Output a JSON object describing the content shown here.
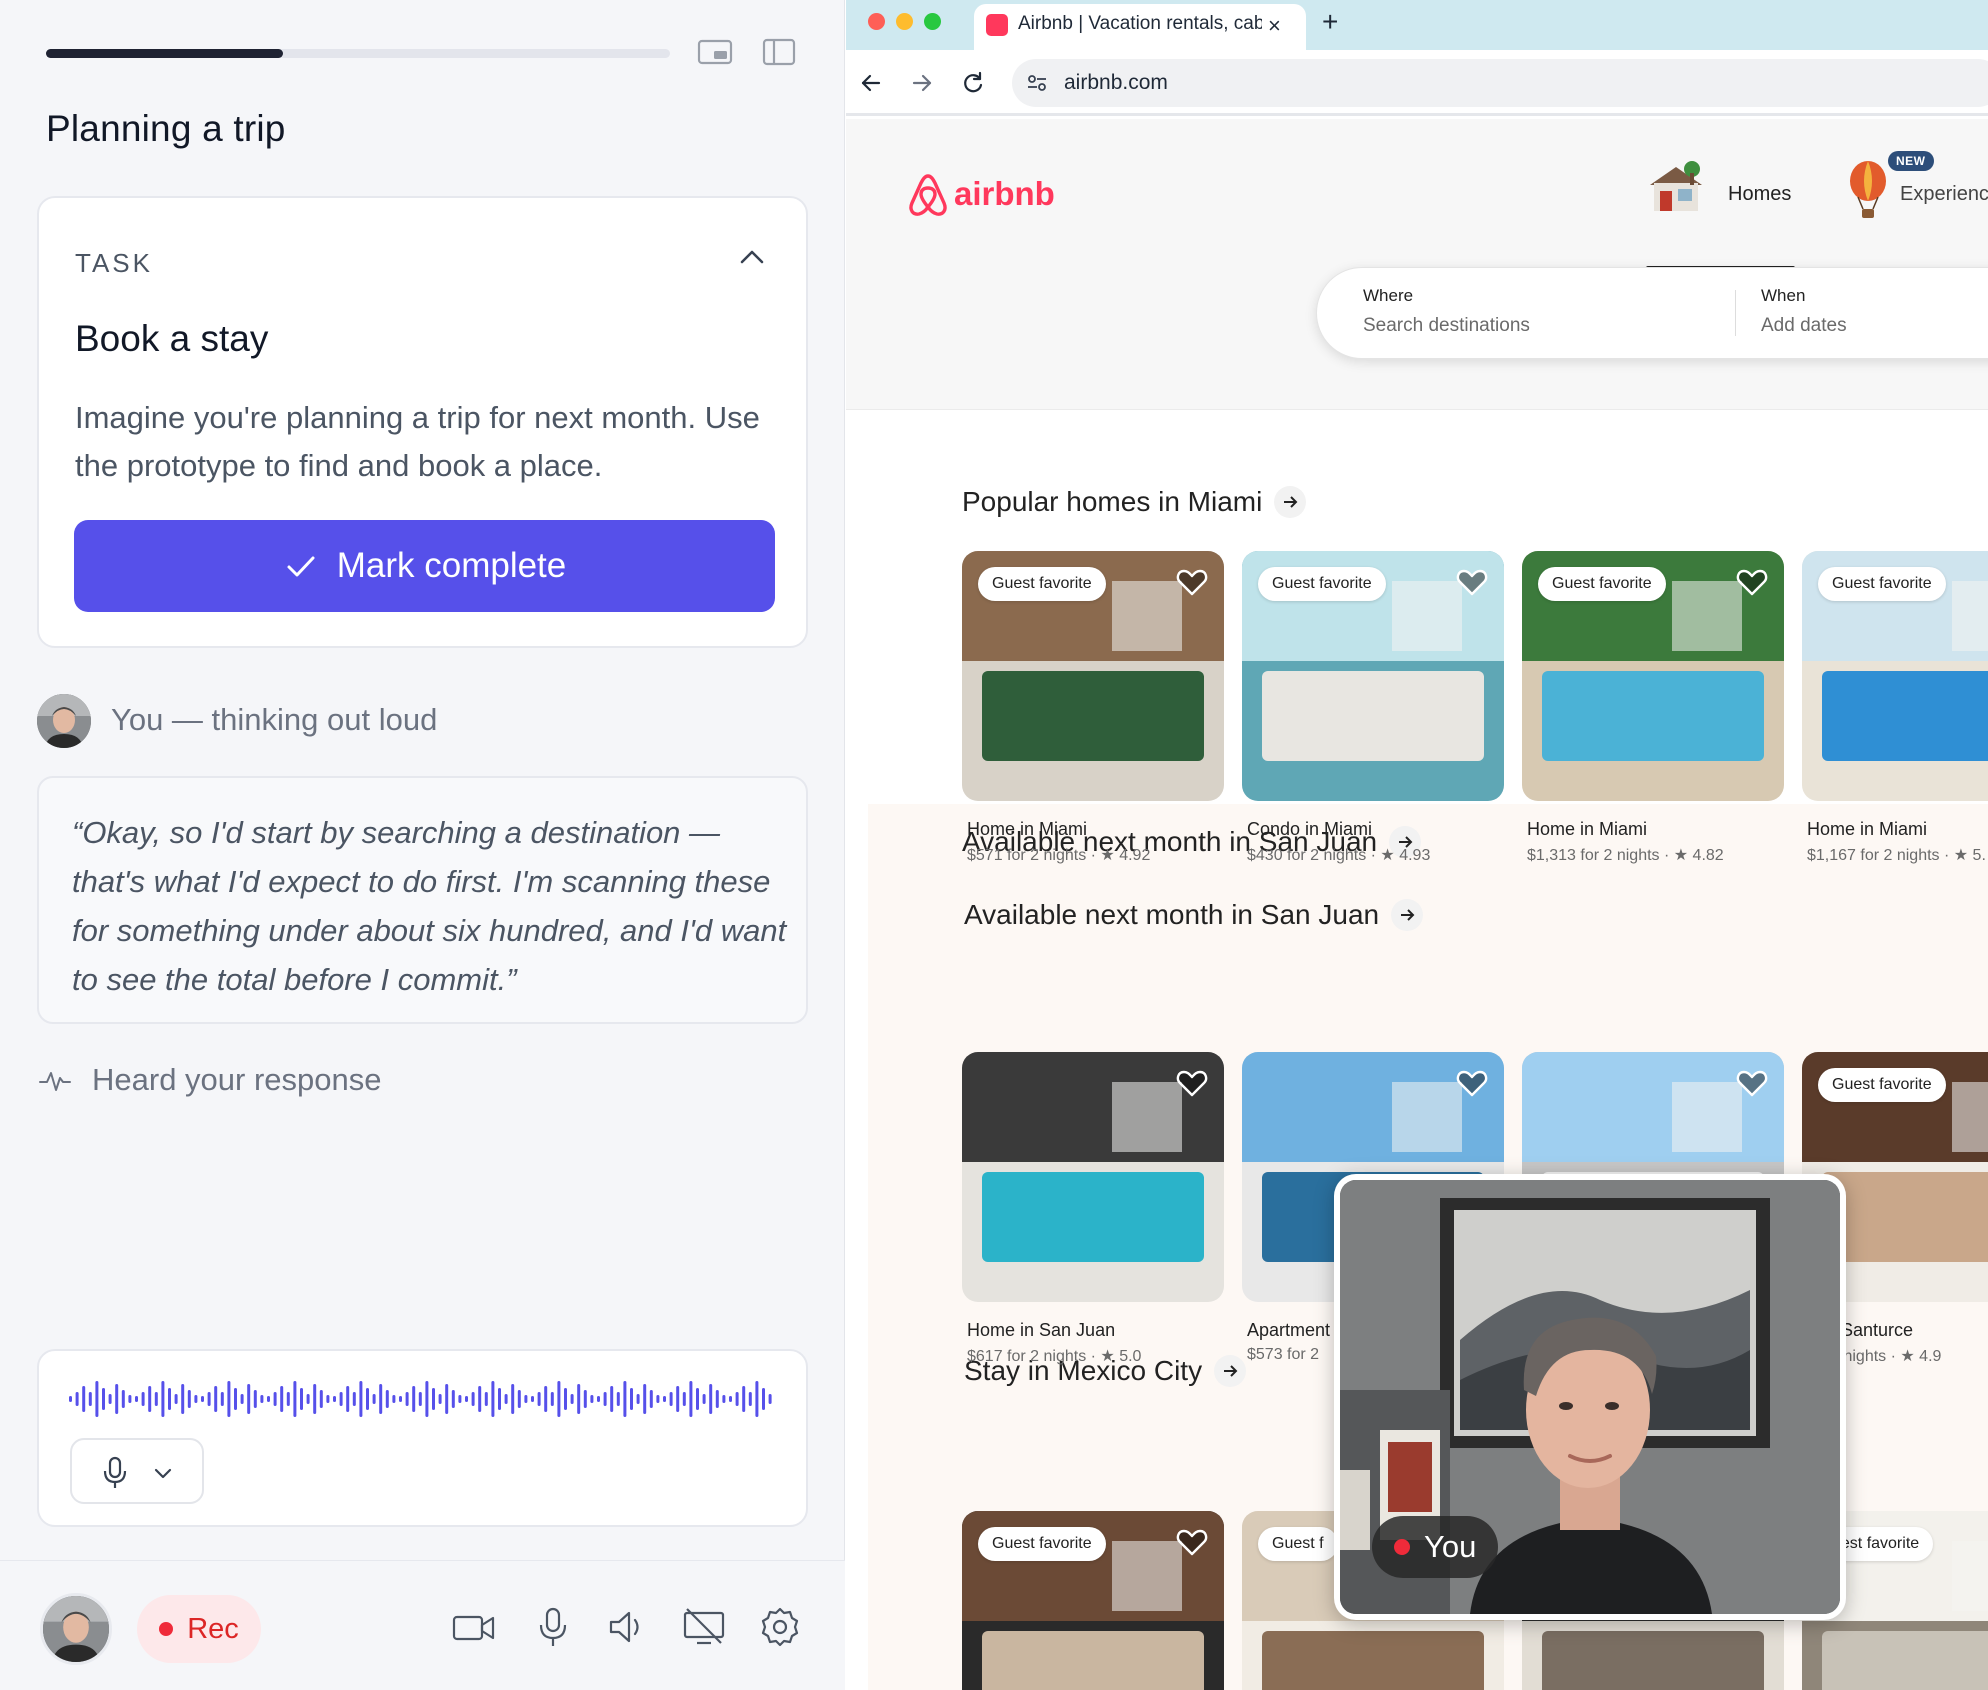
{
  "session": {
    "title": "Planning a trip",
    "progress": 0.38
  },
  "task": {
    "label": "TASK",
    "title": "Book a stay",
    "description": "Imagine you're planning a trip for next month. Use the prototype to find and book a place.",
    "complete_button": "Mark complete"
  },
  "transcript": {
    "speaker": "You — thinking out loud",
    "quote": "“Okay, so I'd start by searching a destination — that's what I'd expect to do first. I'm scanning these for something under about six hundred, and I'd want to see the total before I commit.”",
    "status": "Heard your response"
  },
  "recorder": {
    "rec_label": "Rec",
    "accent": "#5650ea"
  },
  "browser": {
    "tab_title": "Airbnb | Vacation rentals, cabins",
    "url": "airbnb.com"
  },
  "airbnb": {
    "logo": "airbnb",
    "nav": {
      "homes": "Homes",
      "experiences": "Experiences",
      "new_badge": "NEW"
    },
    "search": {
      "where_label": "Where",
      "where_placeholder": "Search destinations",
      "when_label": "When",
      "when_placeholder": "Add dates"
    },
    "sections": [
      {
        "title": "Popular homes in Miami",
        "listings": [
          {
            "badge": "Guest favorite",
            "title": "Home in Miami",
            "sub": "$571 for 2 nights · ★ 4.92"
          },
          {
            "badge": "Guest favorite",
            "title": "Condo in Miami",
            "sub": "$430 for 2 nights · ★ 4.93"
          },
          {
            "badge": "Guest favorite",
            "title": "Home in Miami",
            "sub": "$1,313 for 2 nights · ★ 4.82"
          },
          {
            "badge": "Guest favorite",
            "title": "Home in Miami",
            "sub": "$1,167 for 2 nights · ★ 5."
          }
        ]
      },
      {
        "title": "Available next month in San Juan"
      },
      {
        "title": "Available next month in San Juan",
        "listings": [
          {
            "badge": "",
            "title": "Home in San Juan",
            "sub": "$617 for 2 nights · ★ 5.0"
          },
          {
            "badge": "",
            "title": "Apartment",
            "sub": "$573 for 2"
          },
          {
            "badge": "",
            "title": "",
            "sub": ""
          },
          {
            "badge": "Guest favorite",
            "title": "n in Santurce",
            "sub": "for 2 nights · ★ 4.9"
          }
        ]
      },
      {
        "title": "Stay in Mexico City",
        "listings": [
          {
            "badge": "Guest favorite",
            "title": "",
            "sub": ""
          },
          {
            "badge": "Guest f",
            "title": "",
            "sub": ""
          },
          {
            "badge": "",
            "title": "",
            "sub": ""
          },
          {
            "badge": "uest favorite",
            "title": "",
            "sub": ""
          }
        ]
      }
    ]
  },
  "video": {
    "label": "You"
  }
}
